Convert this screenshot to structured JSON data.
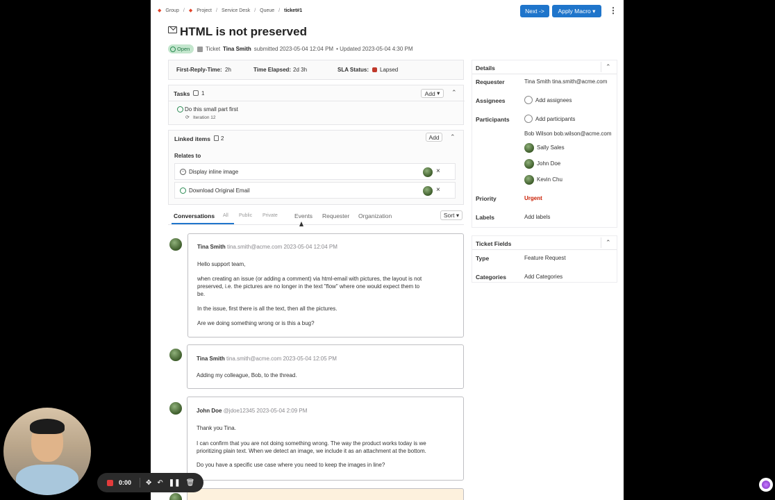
{
  "breadcrumb": [
    "Group",
    "Project",
    "Service Desk",
    "Queue",
    "ticket#1"
  ],
  "header": {
    "next_label": "Next ->",
    "macro_label": "Apply Macro",
    "title": "HTML is not preserved"
  },
  "meta": {
    "status": "Open",
    "type": "Ticket",
    "author": "Tina Smith",
    "submitted": "submitted 2023-05-04 12:04  PM",
    "updated": "• Updated 2023-05-04 4:30 PM"
  },
  "sla": {
    "frt_label": "First-Reply-Time:",
    "frt_value": "2h",
    "elapsed_label": "Time Elapsed:",
    "elapsed_value": "2d 3h",
    "status_label": "SLA Status:",
    "status_value": "Lapsed"
  },
  "tasks": {
    "label": "Tasks",
    "count": "1",
    "add_label": "Add",
    "items": [
      {
        "title": "Do this small part first",
        "iteration": "Iteration 12"
      }
    ]
  },
  "linked": {
    "label": "Linked items",
    "count": "2",
    "add_label": "Add",
    "relates_label": "Relates to",
    "items": [
      {
        "title": "Display inline image"
      },
      {
        "title": "Download Original Email"
      }
    ]
  },
  "tabs": {
    "conversations": "Conversations",
    "all": "All",
    "public": "Public",
    "private": "Private",
    "events": "Events",
    "requester": "Requester",
    "organization": "Organization",
    "sort": "Sort"
  },
  "messages": [
    {
      "author": "Tina Smith",
      "email": "tina.smith@acme.com",
      "time": "2023-05-04 12:04 PM",
      "p1": "Hello support team,",
      "p2a": "when creating an issue (or adding a comment) via html-email with pictures, the layout is not",
      "p2b": "preserved, i.e. the pictures are no longer in the text \"flow\" where one would expect them to",
      "p2c": "be.",
      "p3": "In the issue, first there is all the text, then all the pictures.",
      "p4": "Are we doing something wrong or is this a bug?"
    },
    {
      "author": "Tina Smith",
      "email": "tina.smith@acme.com",
      "time": "2023-05-04 12:05 PM",
      "p1": "Adding my colleague, Bob, to the thread."
    },
    {
      "author": "John Doe",
      "email": "@jdoe12345",
      "time": "2023-05-04 2:09 PM",
      "p1": "Thank you Tina.",
      "p2a": "I can confirm that you are not doing something wrong. The way the product works today is we",
      "p2b": "prioritizing plain text. When we detect an image, we include it as an attachment at the bottom.",
      "p3": "Do you have a specific use case where you need to keep the images in line?"
    }
  ],
  "details": {
    "label": "Details",
    "requester_label": "Requester",
    "requester_value": "Tina Smith tina.smith@acme.com",
    "assignees_label": "Assignees",
    "assignees_value": "Add assignees",
    "participants_label": "Participants",
    "participants_add": "Add participants",
    "participant_email": "Bob Wilson bob.wilson@acme.com",
    "participants": [
      "Sally Sales",
      "John Doe",
      "Kevin Chu"
    ],
    "priority_label": "Priority",
    "priority_value": "Urgent",
    "labels_label": "Labels",
    "labels_value": "Add labels"
  },
  "ticket_fields": {
    "label": "Ticket Fields",
    "type_label": "Type",
    "type_value": "Feature Request",
    "categories_label": "Categories",
    "categories_value": "Add Categories"
  },
  "recorder": {
    "time": "0:00"
  },
  "colors": {
    "accent": "#1f75cb",
    "urgent": "#c91c00",
    "open_badge": "#c3e6cd",
    "lapsed": "#c0392b"
  }
}
